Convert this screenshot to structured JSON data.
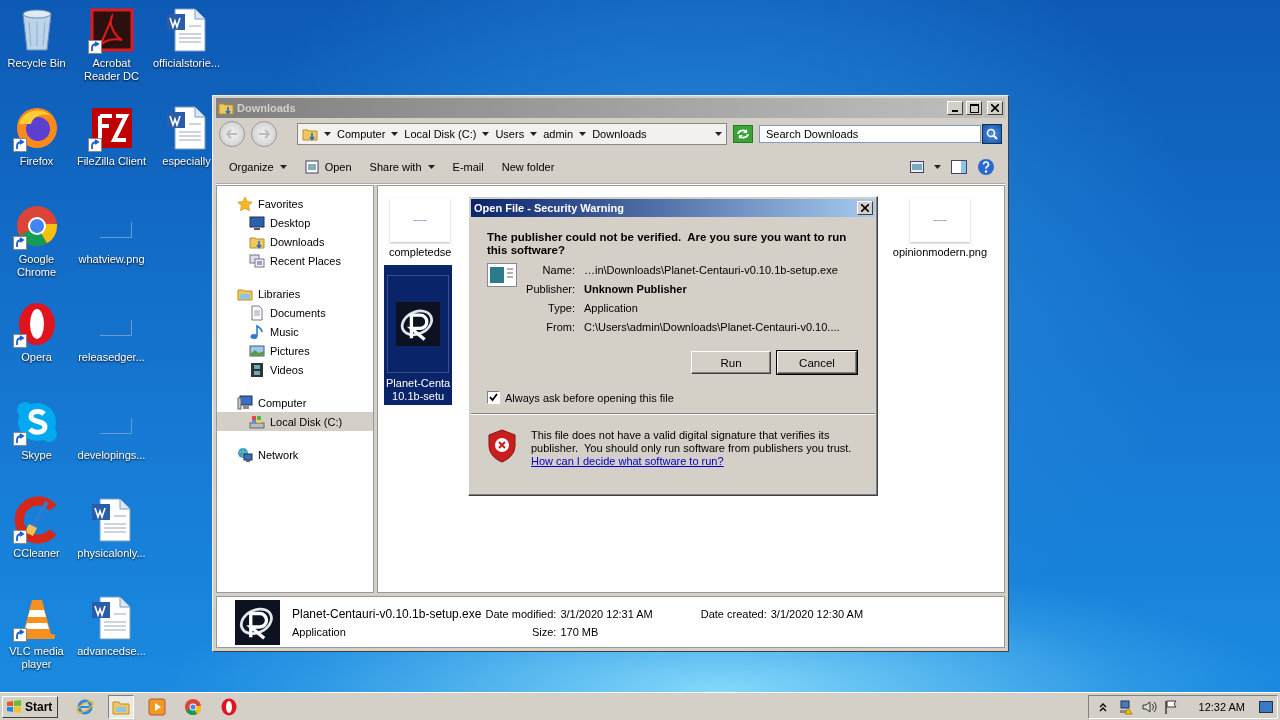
{
  "desktop": {
    "icons": [
      {
        "label": "Recycle Bin",
        "kind": "recycle-bin",
        "shortcut": false
      },
      {
        "label": "Firefox",
        "kind": "firefox",
        "shortcut": true
      },
      {
        "label": "Google Chrome",
        "kind": "chrome",
        "shortcut": true
      },
      {
        "label": "Opera",
        "kind": "opera",
        "shortcut": true
      },
      {
        "label": "Skype",
        "kind": "skype",
        "shortcut": true
      },
      {
        "label": "CCleaner",
        "kind": "ccleaner",
        "shortcut": true
      },
      {
        "label": "VLC media player",
        "kind": "vlc",
        "shortcut": true
      },
      {
        "label": "Acrobat Reader DC",
        "kind": "acrobat",
        "shortcut": true
      },
      {
        "label": "FileZilla Client",
        "kind": "filezilla",
        "shortcut": true
      },
      {
        "label": "whatview.png",
        "kind": "image",
        "shortcut": false
      },
      {
        "label": "releasedger...",
        "kind": "image",
        "shortcut": false
      },
      {
        "label": "developings...",
        "kind": "image",
        "shortcut": false
      },
      {
        "label": "physicalonly...",
        "kind": "word",
        "shortcut": false
      },
      {
        "label": "advancedse...",
        "kind": "word",
        "shortcut": false
      },
      {
        "label": "officialstorie...",
        "kind": "word",
        "shortcut": false
      },
      {
        "label": "especially",
        "kind": "word",
        "shortcut": false
      }
    ]
  },
  "explorer": {
    "title": "Downloads",
    "breadcrumb": [
      "Computer",
      "Local Disk (C:)",
      "Users",
      "admin",
      "Downloads"
    ],
    "search": {
      "placeholder": "Search Downloads"
    },
    "toolbar": [
      {
        "label": "Organize",
        "kind": "menu"
      },
      {
        "label": "Open",
        "kind": "open"
      },
      {
        "label": "Share with",
        "kind": "menu"
      },
      {
        "label": "E-mail",
        "kind": "plain"
      },
      {
        "label": "New folder",
        "kind": "plain"
      }
    ],
    "nav": [
      {
        "label": "Favorites",
        "kind": "star",
        "selected": false,
        "children": [
          {
            "label": "Desktop",
            "kind": "desktop",
            "selected": false
          },
          {
            "label": "Downloads",
            "kind": "downloads",
            "selected": false
          },
          {
            "label": "Recent Places",
            "kind": "recent",
            "selected": false
          }
        ]
      },
      {
        "label": "Libraries",
        "kind": "libraries",
        "selected": false,
        "children": [
          {
            "label": "Documents",
            "kind": "documents",
            "selected": false
          },
          {
            "label": "Music",
            "kind": "music",
            "selected": false
          },
          {
            "label": "Pictures",
            "kind": "pictures",
            "selected": false
          },
          {
            "label": "Videos",
            "kind": "videos",
            "selected": false
          }
        ]
      },
      {
        "label": "Computer",
        "kind": "computer",
        "selected": false,
        "children": [
          {
            "label": "Local Disk (C:)",
            "kind": "drive",
            "selected": true
          }
        ]
      },
      {
        "label": "Network",
        "kind": "network",
        "selected": false
      }
    ],
    "files": [
      {
        "lines": [
          "completedse"
        ],
        "kind": "image",
        "selected": false
      },
      {
        "lines": [
          "opinionmodern.png"
        ],
        "kind": "image",
        "selected": false
      },
      {
        "lines": [
          "Planet-Centa",
          "10.1b-setu"
        ],
        "kind": "app",
        "selected": true
      }
    ],
    "details": {
      "name": "Planet-Centauri-v0.10.1b-setup.exe",
      "type": "Application",
      "fields": [
        {
          "label": "Date modified:",
          "value": "3/1/2020 12:31 AM"
        },
        {
          "label": "Date created:",
          "value": "3/1/2020 12:30 AM"
        },
        {
          "label": "Size:",
          "value": "170 MB"
        }
      ]
    }
  },
  "dialog": {
    "title": "Open File - Security Warning",
    "heading": "The publisher could not be verified.  Are you sure you want to run this software?",
    "fields": [
      {
        "label": "Name:",
        "value": "…in\\Downloads\\Planet-Centauri-v0.10.1b-setup.exe",
        "kind": "plain"
      },
      {
        "label": "Publisher:",
        "value": "Unknown Publisher",
        "kind": "bold"
      },
      {
        "label": "Type:",
        "value": "Application",
        "kind": "plain"
      },
      {
        "label": "From:",
        "value": "C:\\Users\\admin\\Downloads\\Planet-Centauri-v0.10....",
        "kind": "plain"
      }
    ],
    "buttons": [
      {
        "label": "Run",
        "focused": false
      },
      {
        "label": "Cancel",
        "focused": true
      }
    ],
    "checkbox": {
      "label": "Always ask before opening this file",
      "checked": true
    },
    "warning": "This file does not have a valid digital signature that verifies its publisher.  You should only run software from publishers you trust.",
    "link": "How can I decide what software to run?"
  },
  "taskbar": {
    "start": "Start",
    "apps": [
      {
        "kind": "ie",
        "selected": false
      },
      {
        "kind": "folder",
        "selected": true
      },
      {
        "kind": "media",
        "selected": false
      },
      {
        "kind": "chrome",
        "selected": false
      },
      {
        "kind": "opera",
        "selected": false
      }
    ],
    "tray": [
      {
        "kind": "chevron"
      },
      {
        "kind": "network"
      },
      {
        "kind": "volume"
      },
      {
        "kind": "flag"
      }
    ],
    "clock": "12:32 AM"
  }
}
